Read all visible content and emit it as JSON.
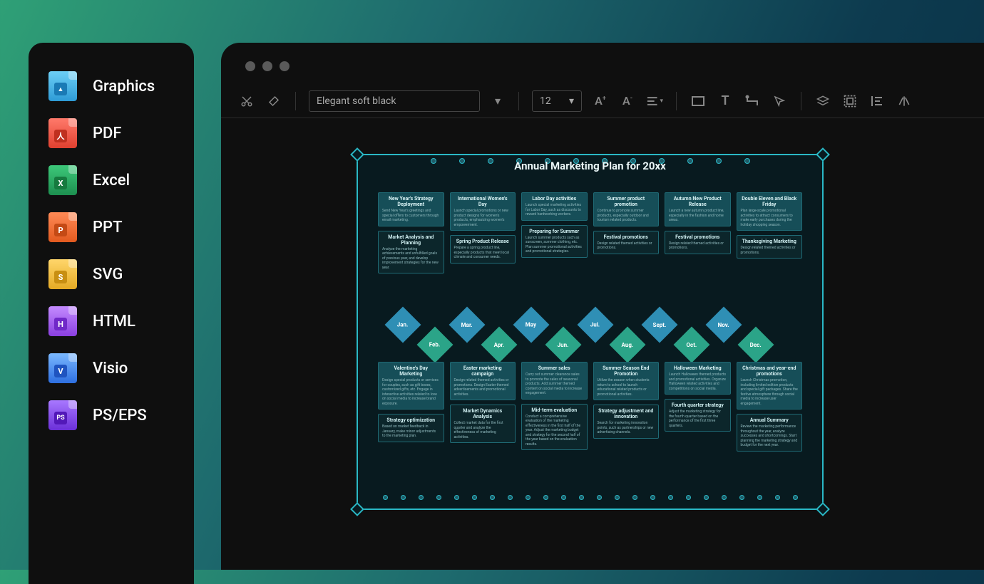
{
  "sidebar": {
    "items": [
      {
        "label": "Graphics",
        "letter": "",
        "color": "fi-blue"
      },
      {
        "label": "PDF",
        "letter": "",
        "color": "fi-red"
      },
      {
        "label": "Excel",
        "letter": "X",
        "color": "fi-green"
      },
      {
        "label": "PPT",
        "letter": "P",
        "color": "fi-orange"
      },
      {
        "label": "SVG",
        "letter": "S",
        "color": "fi-yellow"
      },
      {
        "label": "HTML",
        "letter": "H",
        "color": "fi-purple"
      },
      {
        "label": "Visio",
        "letter": "V",
        "color": "fi-blue2"
      },
      {
        "label": "PS/EPS",
        "letter": "PS",
        "color": "fi-purple2"
      }
    ]
  },
  "toolbar": {
    "theme": "Elegant soft black",
    "font_size": "12"
  },
  "diagram": {
    "title": "Annual Marketing Plan for 20xx",
    "months": [
      "Jan.",
      "Feb.",
      "Mar.",
      "Apr.",
      "May",
      "Jun.",
      "Jul.",
      "Aug.",
      "Sept.",
      "Oct.",
      "Nov.",
      "Dec."
    ],
    "top_cols": [
      [
        {
          "t": "New Year's Strategy Deployment",
          "b": "Send New Year's greetings and special offers to customers through email marketing."
        },
        {
          "t": "Market Analysis and Planning",
          "b": "Analyze the marketing achievements and unfulfilled goals of previous year, and develop improvement strategies for the new year."
        }
      ],
      [
        {
          "t": "International Women's Day",
          "b": "Launch special promotions or new product designs for women's products, emphasizing women's empowerment."
        },
        {
          "t": "Spring Product Release",
          "b": "Prepare a spring product line, especially products that meet local climate and consumer needs."
        }
      ],
      [
        {
          "t": "Labor Day activities",
          "b": "Launch special marketing activities for Labor Day, such as discounts to reward hardworking workers."
        },
        {
          "t": "Preparing for Summer",
          "b": "Launch summer products such as sunscreen, summer clothing, etc. Plan summer promotional activities and promotional strategies."
        }
      ],
      [
        {
          "t": "Summer product promotion",
          "b": "Continue to promote summer products, especially outdoor and tourism related products."
        },
        {
          "t": "Festival promotions",
          "b": "Design related themed activities or promotions."
        }
      ],
      [
        {
          "t": "Autumn New Product Release",
          "b": "Launch a new autumn product line, especially in the fashion and home areas."
        },
        {
          "t": "Festival promotions",
          "b": "Design related themed activities or promotions."
        }
      ],
      [
        {
          "t": "Double Eleven and Black Friday",
          "b": "Plan large-scale promotional activities to attract consumers to make early purchases during the holiday shopping season."
        },
        {
          "t": "Thanksgiving Marketing",
          "b": "Design related themed activities or promotions."
        }
      ]
    ],
    "bot_cols": [
      [
        {
          "t": "Valentine's Day Marketing",
          "b": "Design special products or services for couples, such as gift boxes, customized gifts, etc. Engage in interactive activities related to love on social media to increase brand exposure."
        },
        {
          "t": "Strategy optimization",
          "b": "Based on market feedback in January, make minor adjustments to the marketing plan."
        }
      ],
      [
        {
          "t": "Easter marketing campaign",
          "b": "Design related themed activities or promotions. Design Easter themed advertisements and promotional activities."
        },
        {
          "t": "Market Dynamics Analysis",
          "b": "Collect market data for the first quarter and analyze the effectiveness of marketing activities."
        }
      ],
      [
        {
          "t": "Summer sales",
          "b": "Carry out summer clearance sales to promote the sales of seasonal products. Add summer themed content on social media to increase engagement."
        },
        {
          "t": "Mid-term evaluation",
          "b": "Conduct a comprehensive evaluation of the marketing effectiveness in the first half of the year. Adjust the marketing budget and strategy for the second half of the year based on the evaluation results."
        }
      ],
      [
        {
          "t": "Summer Season End Promotion",
          "b": "Utilize the season when students return to school to launch educational related products or promotional activities."
        },
        {
          "t": "Strategy adjustment and innovation",
          "b": "Search for marketing innovation points, such as partnerships or new advertising channels."
        }
      ],
      [
        {
          "t": "Halloween Marketing",
          "b": "Launch Halloween themed products and promotional activities. Organize Halloween related activities and competitions on social media."
        },
        {
          "t": "Fourth quarter strategy",
          "b": "Adjust the marketing strategy for the fourth quarter based on the performance of the first three quarters."
        }
      ],
      [
        {
          "t": "Christmas and year-end promotions",
          "b": "Launch Christmas promotion, including limited edition products and special gift packages. Share the festive atmosphere through social media to increase user engagement."
        },
        {
          "t": "Annual Summary",
          "b": "Review the marketing performance throughout the year, analyze successes and shortcomings. Start planning the marketing strategy and budget for the next year."
        }
      ]
    ]
  }
}
